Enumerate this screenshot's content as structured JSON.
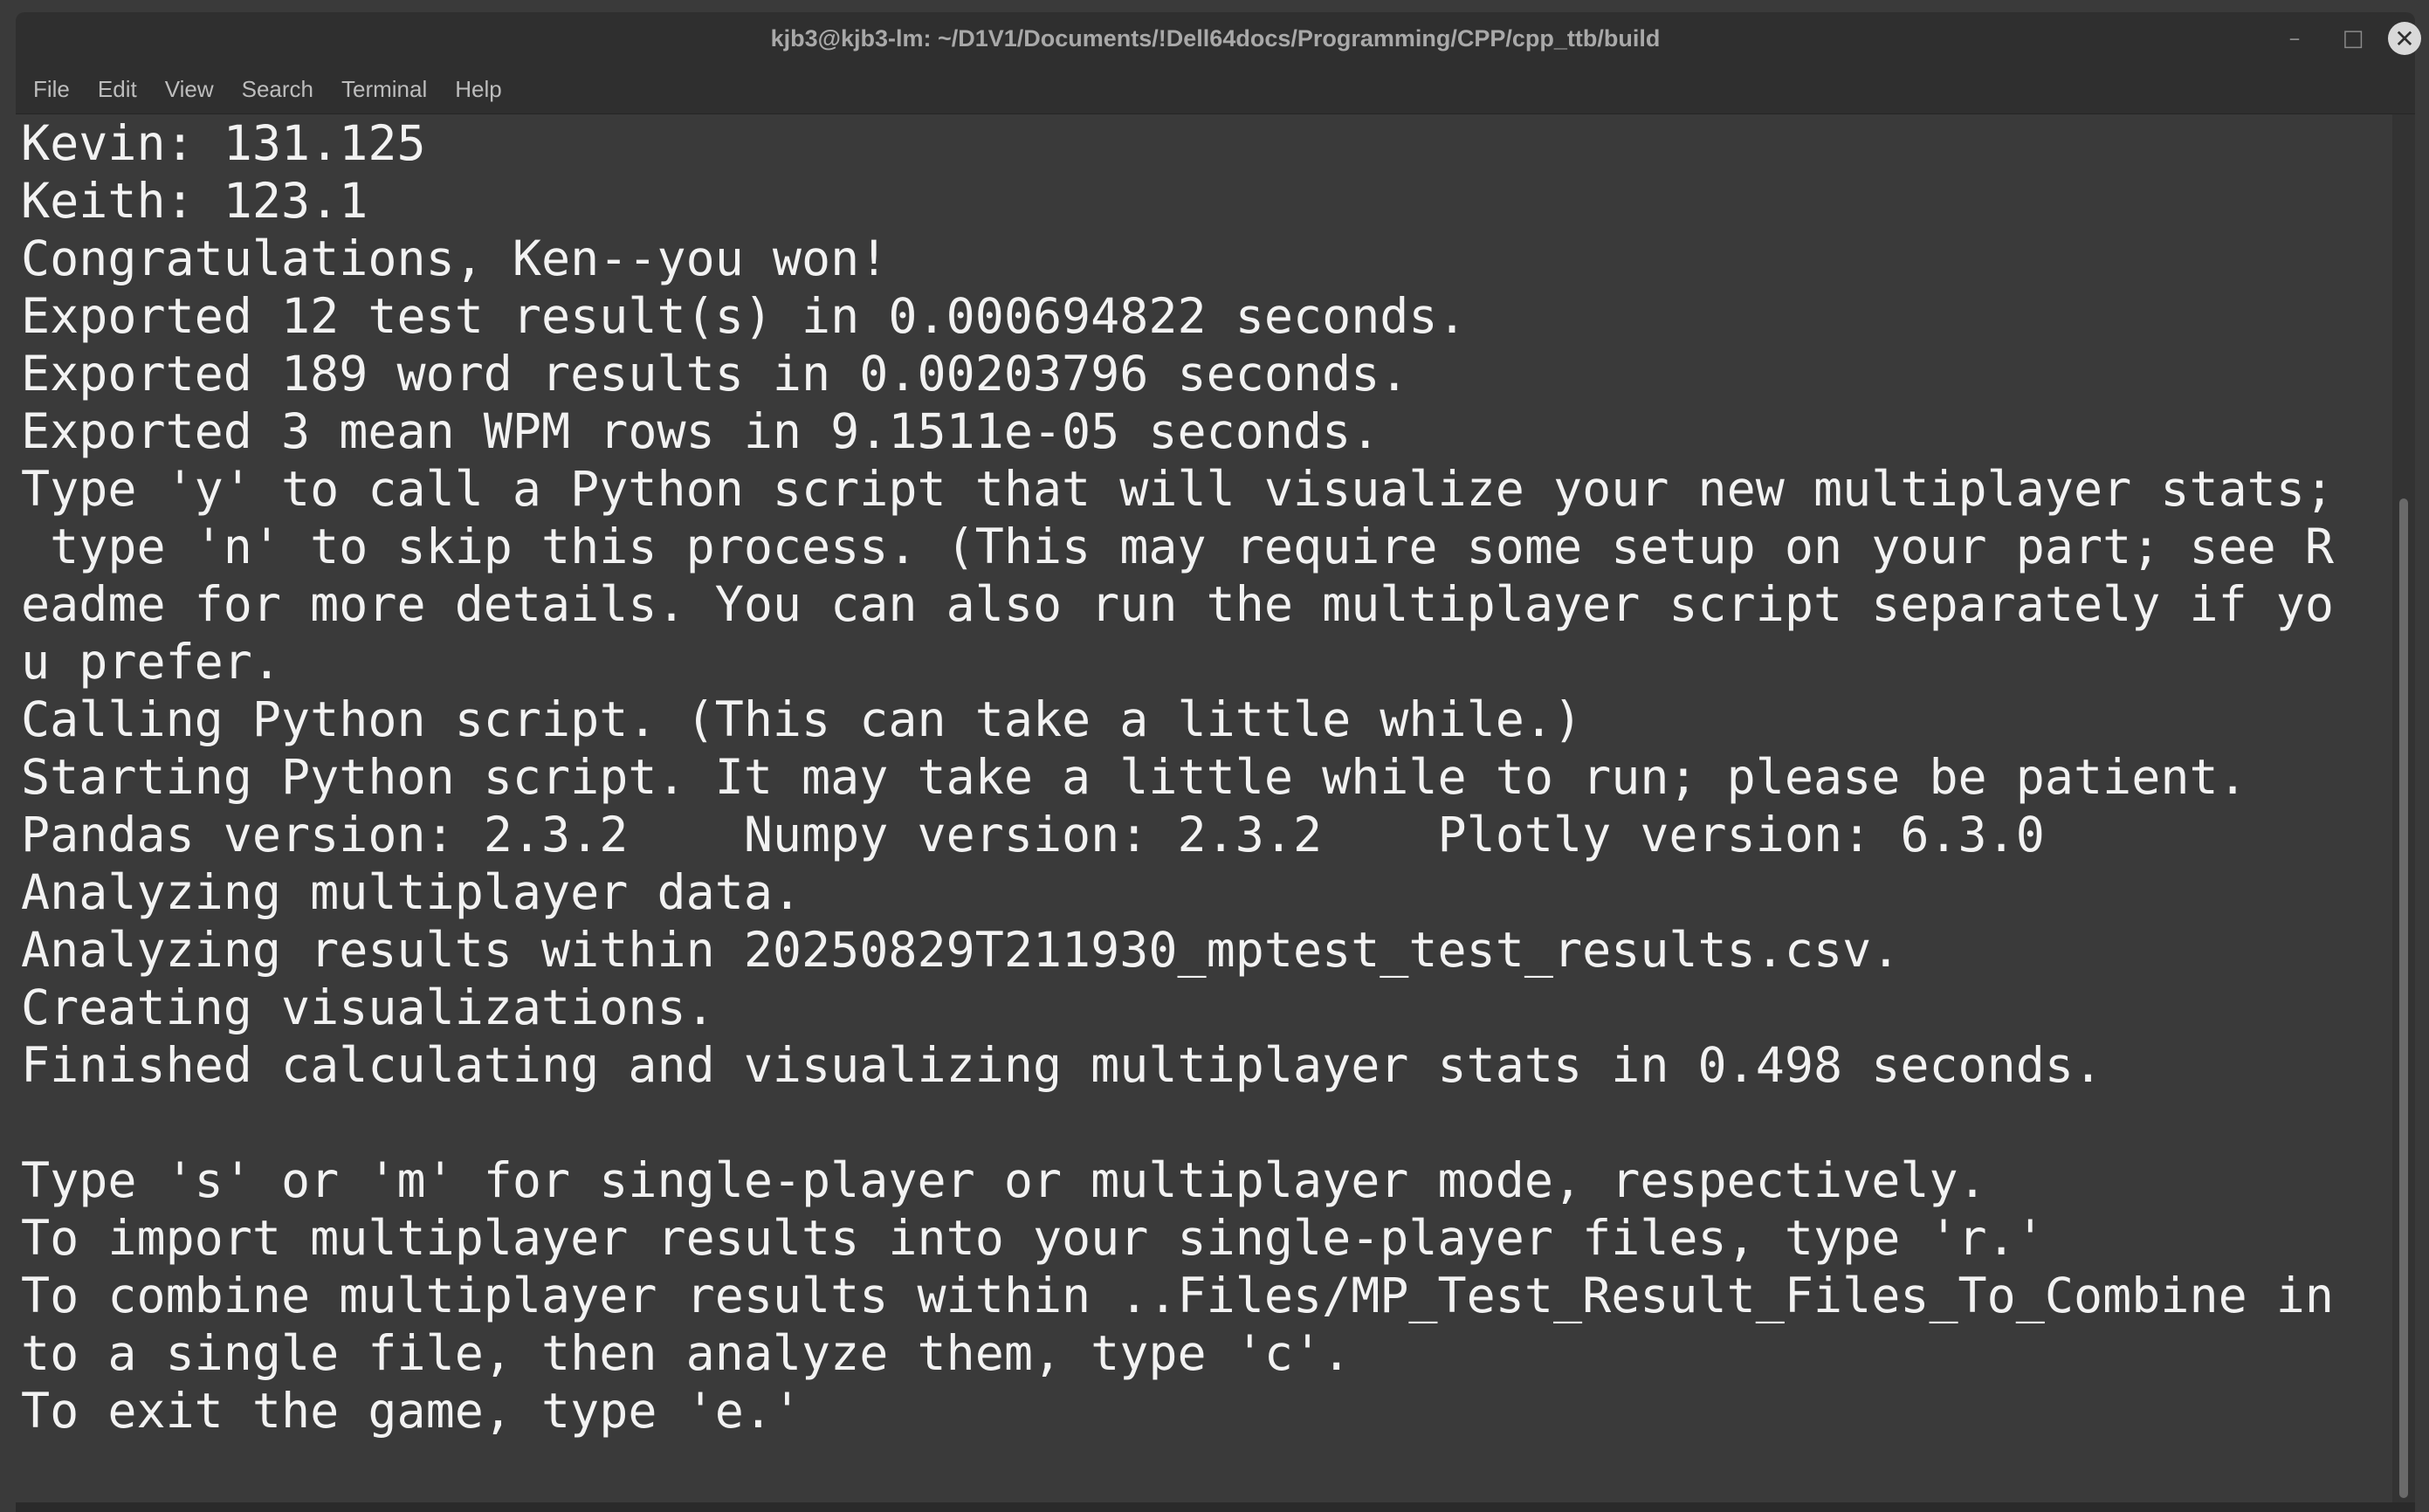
{
  "window": {
    "title": "kjb3@kjb3-lm: ~/D1V1/Documents/!Dell64docs/Programming/CPP/cpp_ttb/build",
    "minimize_icon": "minimize-icon",
    "maximize_icon": "maximize-icon",
    "close_icon": "close-icon"
  },
  "menu": {
    "items": [
      {
        "label": "File"
      },
      {
        "label": "Edit"
      },
      {
        "label": "View"
      },
      {
        "label": "Search"
      },
      {
        "label": "Terminal"
      },
      {
        "label": "Help"
      }
    ]
  },
  "terminal": {
    "lines": [
      "Kevin: 131.125",
      "Keith: 123.1",
      "Congratulations, Ken--you won!",
      "Exported 12 test result(s) in 0.000694822 seconds.",
      "Exported 189 word results in 0.00203796 seconds.",
      "Exported 3 mean WPM rows in 9.1511e-05 seconds.",
      "Type 'y' to call a Python script that will visualize your new multiplayer stats;",
      " type 'n' to skip this process. (This may require some setup on your part; see R",
      "eadme for more details. You can also run the multiplayer script separately if yo",
      "u prefer.",
      "Calling Python script. (This can take a little while.)",
      "Starting Python script. It may take a little while to run; please be patient.",
      "Pandas version: 2.3.2    Numpy version: 2.3.2    Plotly version: 6.3.0",
      "Analyzing multiplayer data.",
      "Analyzing results within 20250829T211930_mptest_test_results.csv.",
      "Creating visualizations.",
      "Finished calculating and visualizing multiplayer stats in 0.498 seconds.",
      "",
      "Type 's' or 'm' for single-player or multiplayer mode, respectively.",
      "To import multiplayer results into your single-player files, type 'r.'",
      "To combine multiplayer results within ..Files/MP_Test_Result_Files_To_Combine in",
      "to a single file, then analyze them, type 'c'.",
      "To exit the game, type 'e.'"
    ]
  }
}
